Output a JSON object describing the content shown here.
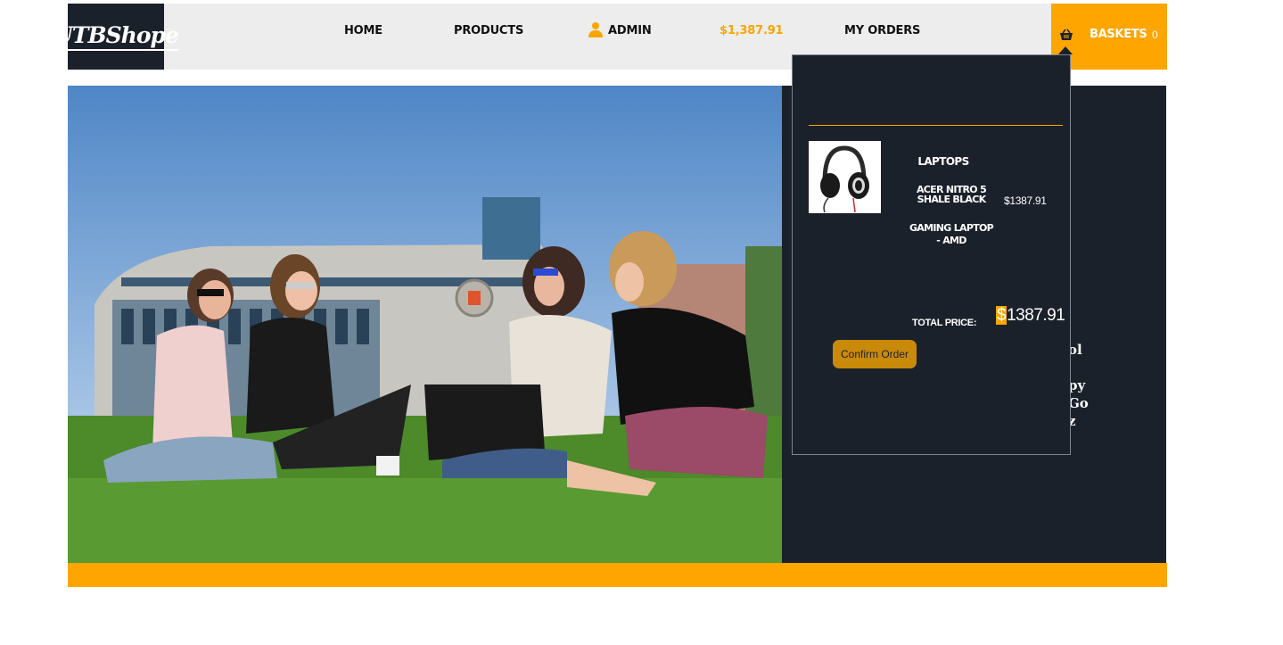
{
  "header": {
    "logo": "UTBShope",
    "nav": {
      "home": "HOME",
      "products": "PRODUCTS",
      "admin": "ADMIN",
      "balance": "$1,387.91",
      "orders": "MY ORDERS"
    },
    "baskets": {
      "label": "BASKETS",
      "count": "0"
    }
  },
  "basket_dropdown": {
    "item": {
      "category": "LAPTOPS",
      "name_line1": "ACER NITRO 5 SHALE BLACK",
      "name_line2": "GAMING LAPTOP - AMD",
      "price": "$1387.91"
    },
    "total_label": "TOTAL PRICE:",
    "total_currency": "$",
    "total_value": "1387.91",
    "confirm_label": "Confirm Order"
  },
  "hero": {
    "side_text": [
      "ol",
      "py",
      "Go",
      "z"
    ]
  },
  "colors": {
    "accent": "#ffa500",
    "dark": "#1b212a"
  }
}
